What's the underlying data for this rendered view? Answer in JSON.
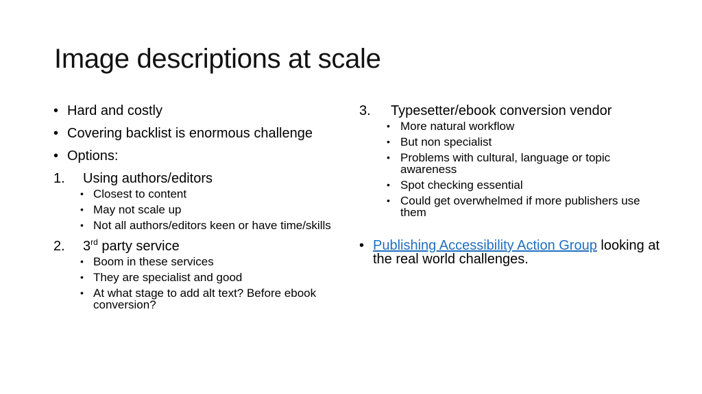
{
  "slide": {
    "title": "Image descriptions at scale",
    "link_color": "#1f6fbf",
    "left": {
      "bullets": [
        "Hard and costly",
        "Covering backlist is enormous challenge",
        "Options:"
      ],
      "options": [
        {
          "number": "1.",
          "label": "Using authors/editors",
          "subitems": [
            "Closest to content",
            "May not scale up",
            "Not all authors/editors keen or have time/skills"
          ]
        },
        {
          "number": "2.",
          "label_prefix": "3",
          "label_sup": "rd",
          "label_suffix": " party service",
          "subitems": [
            "Boom in these services",
            "They are specialist and good",
            "At what stage to add alt text? Before ebook conversion?"
          ]
        }
      ]
    },
    "right": {
      "options": [
        {
          "number": "3.",
          "label": "Typesetter/ebook conversion vendor",
          "subitems": [
            "More natural workflow",
            "But non specialist",
            "Problems with cultural, language or topic awareness",
            "Spot checking essential",
            "Could get overwhelmed if more publishers use them"
          ]
        }
      ],
      "final_bullet": {
        "link_text": "Publishing Accessibility Action Group",
        "text": " looking at the real world challenges."
      }
    },
    "bullet_glyph": "•"
  }
}
